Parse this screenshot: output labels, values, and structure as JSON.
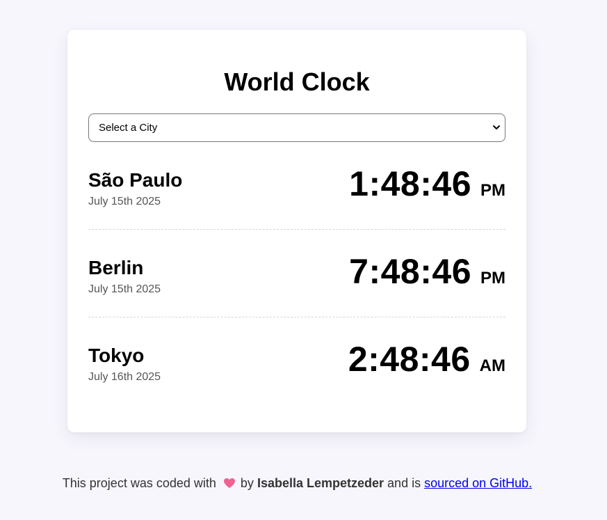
{
  "header": {
    "title": "World Clock"
  },
  "city_select": {
    "selected": "Select a City"
  },
  "cities": [
    {
      "name": "São Paulo",
      "date": "July 15th 2025",
      "time": "1:48:46",
      "ampm": "PM"
    },
    {
      "name": "Berlin",
      "date": "July 15th 2025",
      "time": "7:48:46",
      "ampm": "PM"
    },
    {
      "name": "Tokyo",
      "date": "July 16th 2025",
      "time": "2:48:46",
      "ampm": "AM"
    }
  ],
  "footer": {
    "text_before": "This project was coded with",
    "text_by": "by",
    "author": "Isabella Lempetzeder",
    "text_middle": "and is",
    "link_text": "sourced on GitHub."
  },
  "icons": {
    "heart": "heart-icon",
    "chevron": "chevron-down-icon"
  },
  "colors": {
    "background": "#f7f6fc",
    "card": "#ffffff",
    "heart": "#f06292",
    "link": "#0000ee"
  }
}
